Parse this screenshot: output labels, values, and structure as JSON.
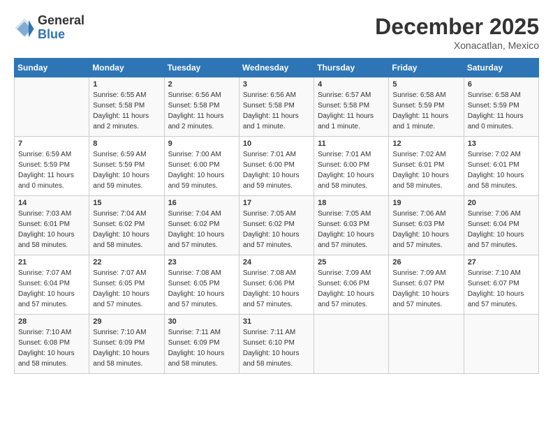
{
  "logo": {
    "general": "General",
    "blue": "Blue"
  },
  "title": "December 2025",
  "location": "Xonacatlan, Mexico",
  "weekdays": [
    "Sunday",
    "Monday",
    "Tuesday",
    "Wednesday",
    "Thursday",
    "Friday",
    "Saturday"
  ],
  "weeks": [
    [
      {
        "day": "",
        "sunrise": "",
        "sunset": "",
        "daylight": ""
      },
      {
        "day": "1",
        "sunrise": "Sunrise: 6:55 AM",
        "sunset": "Sunset: 5:58 PM",
        "daylight": "Daylight: 11 hours and 2 minutes."
      },
      {
        "day": "2",
        "sunrise": "Sunrise: 6:56 AM",
        "sunset": "Sunset: 5:58 PM",
        "daylight": "Daylight: 11 hours and 2 minutes."
      },
      {
        "day": "3",
        "sunrise": "Sunrise: 6:56 AM",
        "sunset": "Sunset: 5:58 PM",
        "daylight": "Daylight: 11 hours and 1 minute."
      },
      {
        "day": "4",
        "sunrise": "Sunrise: 6:57 AM",
        "sunset": "Sunset: 5:58 PM",
        "daylight": "Daylight: 11 hours and 1 minute."
      },
      {
        "day": "5",
        "sunrise": "Sunrise: 6:58 AM",
        "sunset": "Sunset: 5:59 PM",
        "daylight": "Daylight: 11 hours and 1 minute."
      },
      {
        "day": "6",
        "sunrise": "Sunrise: 6:58 AM",
        "sunset": "Sunset: 5:59 PM",
        "daylight": "Daylight: 11 hours and 0 minutes."
      }
    ],
    [
      {
        "day": "7",
        "sunrise": "Sunrise: 6:59 AM",
        "sunset": "Sunset: 5:59 PM",
        "daylight": "Daylight: 11 hours and 0 minutes."
      },
      {
        "day": "8",
        "sunrise": "Sunrise: 6:59 AM",
        "sunset": "Sunset: 5:59 PM",
        "daylight": "Daylight: 10 hours and 59 minutes."
      },
      {
        "day": "9",
        "sunrise": "Sunrise: 7:00 AM",
        "sunset": "Sunset: 6:00 PM",
        "daylight": "Daylight: 10 hours and 59 minutes."
      },
      {
        "day": "10",
        "sunrise": "Sunrise: 7:01 AM",
        "sunset": "Sunset: 6:00 PM",
        "daylight": "Daylight: 10 hours and 59 minutes."
      },
      {
        "day": "11",
        "sunrise": "Sunrise: 7:01 AM",
        "sunset": "Sunset: 6:00 PM",
        "daylight": "Daylight: 10 hours and 58 minutes."
      },
      {
        "day": "12",
        "sunrise": "Sunrise: 7:02 AM",
        "sunset": "Sunset: 6:01 PM",
        "daylight": "Daylight: 10 hours and 58 minutes."
      },
      {
        "day": "13",
        "sunrise": "Sunrise: 7:02 AM",
        "sunset": "Sunset: 6:01 PM",
        "daylight": "Daylight: 10 hours and 58 minutes."
      }
    ],
    [
      {
        "day": "14",
        "sunrise": "Sunrise: 7:03 AM",
        "sunset": "Sunset: 6:01 PM",
        "daylight": "Daylight: 10 hours and 58 minutes."
      },
      {
        "day": "15",
        "sunrise": "Sunrise: 7:04 AM",
        "sunset": "Sunset: 6:02 PM",
        "daylight": "Daylight: 10 hours and 58 minutes."
      },
      {
        "day": "16",
        "sunrise": "Sunrise: 7:04 AM",
        "sunset": "Sunset: 6:02 PM",
        "daylight": "Daylight: 10 hours and 57 minutes."
      },
      {
        "day": "17",
        "sunrise": "Sunrise: 7:05 AM",
        "sunset": "Sunset: 6:02 PM",
        "daylight": "Daylight: 10 hours and 57 minutes."
      },
      {
        "day": "18",
        "sunrise": "Sunrise: 7:05 AM",
        "sunset": "Sunset: 6:03 PM",
        "daylight": "Daylight: 10 hours and 57 minutes."
      },
      {
        "day": "19",
        "sunrise": "Sunrise: 7:06 AM",
        "sunset": "Sunset: 6:03 PM",
        "daylight": "Daylight: 10 hours and 57 minutes."
      },
      {
        "day": "20",
        "sunrise": "Sunrise: 7:06 AM",
        "sunset": "Sunset: 6:04 PM",
        "daylight": "Daylight: 10 hours and 57 minutes."
      }
    ],
    [
      {
        "day": "21",
        "sunrise": "Sunrise: 7:07 AM",
        "sunset": "Sunset: 6:04 PM",
        "daylight": "Daylight: 10 hours and 57 minutes."
      },
      {
        "day": "22",
        "sunrise": "Sunrise: 7:07 AM",
        "sunset": "Sunset: 6:05 PM",
        "daylight": "Daylight: 10 hours and 57 minutes."
      },
      {
        "day": "23",
        "sunrise": "Sunrise: 7:08 AM",
        "sunset": "Sunset: 6:05 PM",
        "daylight": "Daylight: 10 hours and 57 minutes."
      },
      {
        "day": "24",
        "sunrise": "Sunrise: 7:08 AM",
        "sunset": "Sunset: 6:06 PM",
        "daylight": "Daylight: 10 hours and 57 minutes."
      },
      {
        "day": "25",
        "sunrise": "Sunrise: 7:09 AM",
        "sunset": "Sunset: 6:06 PM",
        "daylight": "Daylight: 10 hours and 57 minutes."
      },
      {
        "day": "26",
        "sunrise": "Sunrise: 7:09 AM",
        "sunset": "Sunset: 6:07 PM",
        "daylight": "Daylight: 10 hours and 57 minutes."
      },
      {
        "day": "27",
        "sunrise": "Sunrise: 7:10 AM",
        "sunset": "Sunset: 6:07 PM",
        "daylight": "Daylight: 10 hours and 57 minutes."
      }
    ],
    [
      {
        "day": "28",
        "sunrise": "Sunrise: 7:10 AM",
        "sunset": "Sunset: 6:08 PM",
        "daylight": "Daylight: 10 hours and 58 minutes."
      },
      {
        "day": "29",
        "sunrise": "Sunrise: 7:10 AM",
        "sunset": "Sunset: 6:09 PM",
        "daylight": "Daylight: 10 hours and 58 minutes."
      },
      {
        "day": "30",
        "sunrise": "Sunrise: 7:11 AM",
        "sunset": "Sunset: 6:09 PM",
        "daylight": "Daylight: 10 hours and 58 minutes."
      },
      {
        "day": "31",
        "sunrise": "Sunrise: 7:11 AM",
        "sunset": "Sunset: 6:10 PM",
        "daylight": "Daylight: 10 hours and 58 minutes."
      },
      {
        "day": "",
        "sunrise": "",
        "sunset": "",
        "daylight": ""
      },
      {
        "day": "",
        "sunrise": "",
        "sunset": "",
        "daylight": ""
      },
      {
        "day": "",
        "sunrise": "",
        "sunset": "",
        "daylight": ""
      }
    ]
  ]
}
